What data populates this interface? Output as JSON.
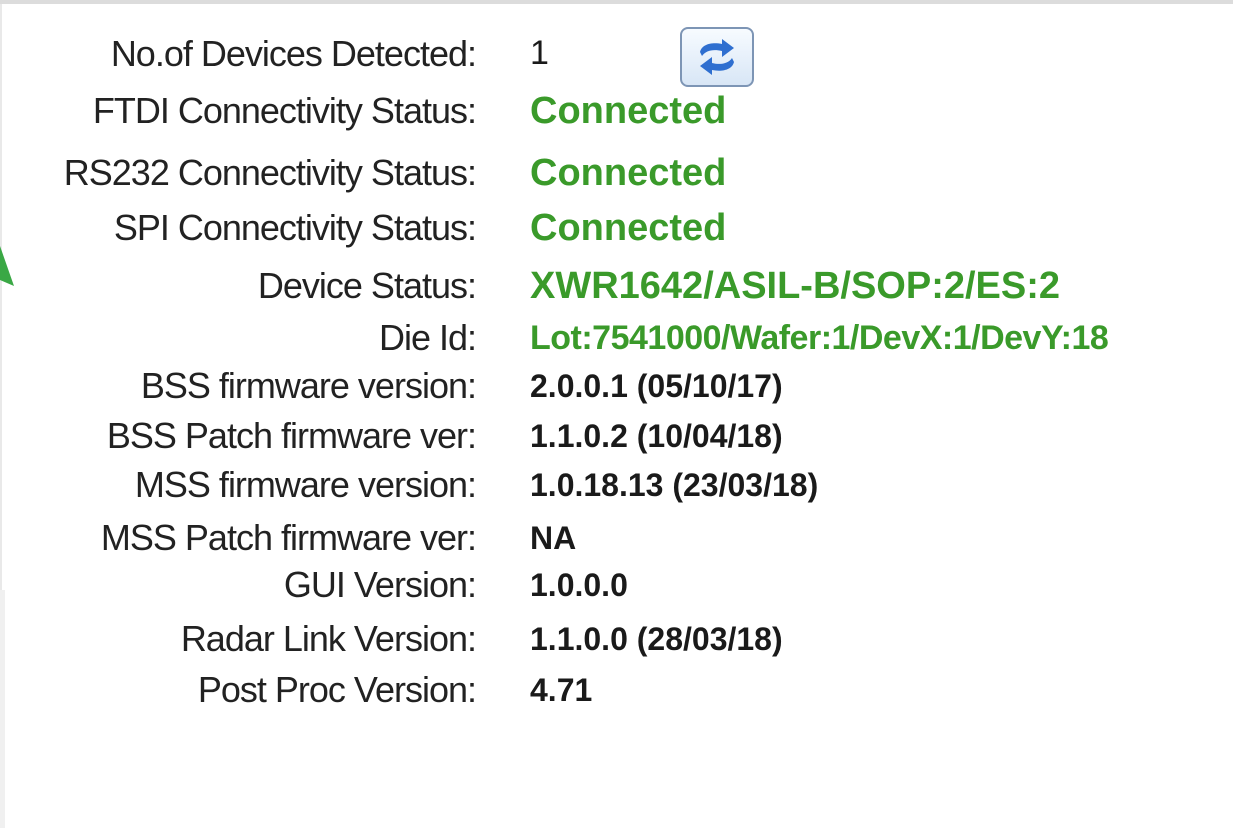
{
  "panel": {
    "rows": [
      {
        "label": "No.of Devices Detected:",
        "value": "1"
      },
      {
        "label": "FTDI Connectivity Status:",
        "value": "Connected"
      },
      {
        "label": "RS232 Connectivity Status:",
        "value": "Connected"
      },
      {
        "label": "SPI Connectivity Status:",
        "value": "Connected"
      },
      {
        "label": "Device Status:",
        "value": "XWR1642/ASIL-B/SOP:2/ES:2"
      },
      {
        "label": "Die Id:",
        "value": "Lot:7541000/Wafer:1/DevX:1/DevY:18"
      },
      {
        "label": "BSS firmware version:",
        "value": "2.0.0.1 (05/10/17)"
      },
      {
        "label": "BSS Patch firmware ver:",
        "value": "1.1.0.2 (10/04/18)"
      },
      {
        "label": "MSS firmware version:",
        "value": "1.0.18.13 (23/03/18)"
      },
      {
        "label": "MSS Patch firmware ver:",
        "value": "NA"
      },
      {
        "label": "GUI Version:",
        "value": "1.0.0.0"
      },
      {
        "label": "Radar Link Version:",
        "value": "1.1.0.0 (28/03/18)"
      },
      {
        "label": "Post Proc Version:",
        "value": "4.71"
      }
    ],
    "refresh_icon": "refresh-arrows-icon"
  },
  "colors": {
    "status_green": "#3a9a2a",
    "label_text": "#222222",
    "value_text": "#1a1a1a",
    "button_border": "#7d95b5",
    "icon_blue": "#2f6fd0"
  }
}
